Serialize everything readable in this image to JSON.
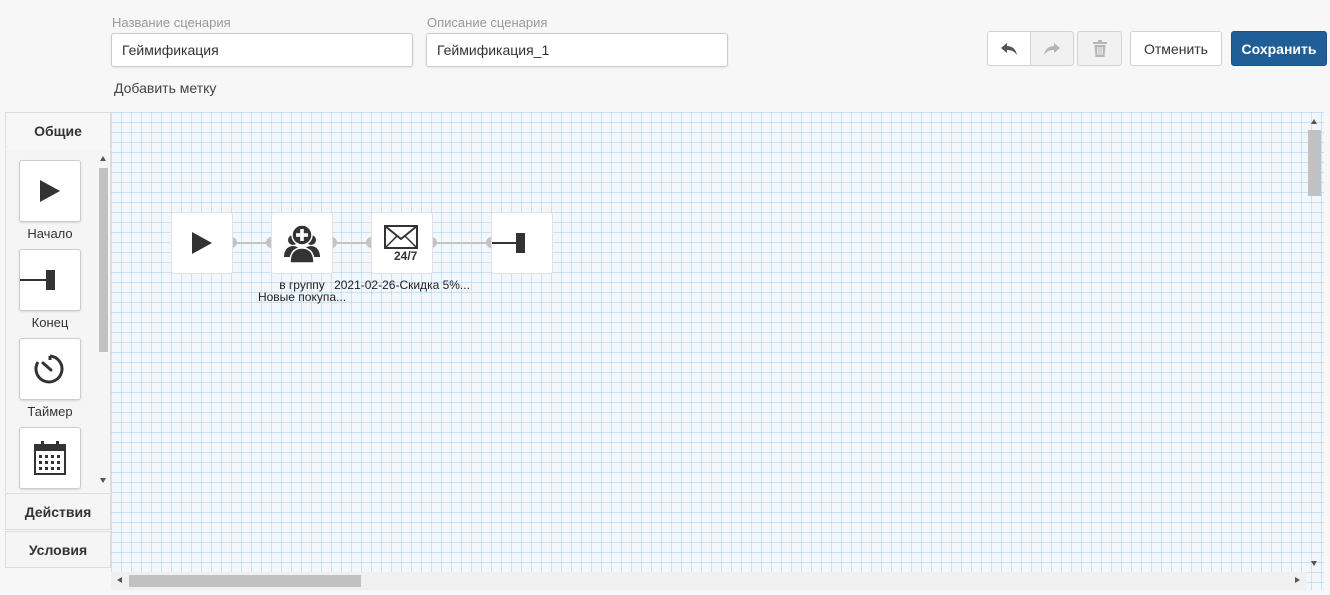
{
  "scenario": {
    "name_label": "Название сценария",
    "name_value": "Геймификация",
    "description_label": "Описание сценария",
    "description_value": "Геймификация_1",
    "add_tag": "Добавить метку"
  },
  "toolbar": {
    "undo_icon": "undo-icon",
    "redo_icon": "redo-icon",
    "delete_icon": "trash-icon",
    "cancel_label": "Отменить",
    "save_label": "Сохранить"
  },
  "sidebar": {
    "tabs": [
      {
        "label": "Общие"
      },
      {
        "label": "Действия"
      },
      {
        "label": "Условия"
      }
    ],
    "items": [
      {
        "label": "Начало",
        "icon": "play-icon"
      },
      {
        "label": "Конец",
        "icon": "end-icon"
      },
      {
        "label": "Таймер",
        "icon": "timer-icon"
      },
      {
        "label": "",
        "icon": "calendar-icon"
      }
    ]
  },
  "flow": {
    "nodes": [
      {
        "icon": "play-icon"
      },
      {
        "icon": "add-to-group-icon",
        "label_line1": "в группу",
        "label_line2": "Новые покупа..."
      },
      {
        "icon": "email-24-7-icon",
        "badge": "24/7",
        "label_line1": "2021-02-26-Скидка 5%..."
      },
      {
        "icon": "end-icon"
      }
    ]
  },
  "colors": {
    "primary": "#1f5e97",
    "grid": "#cfe4f4",
    "connector": "#c3c3c3"
  }
}
